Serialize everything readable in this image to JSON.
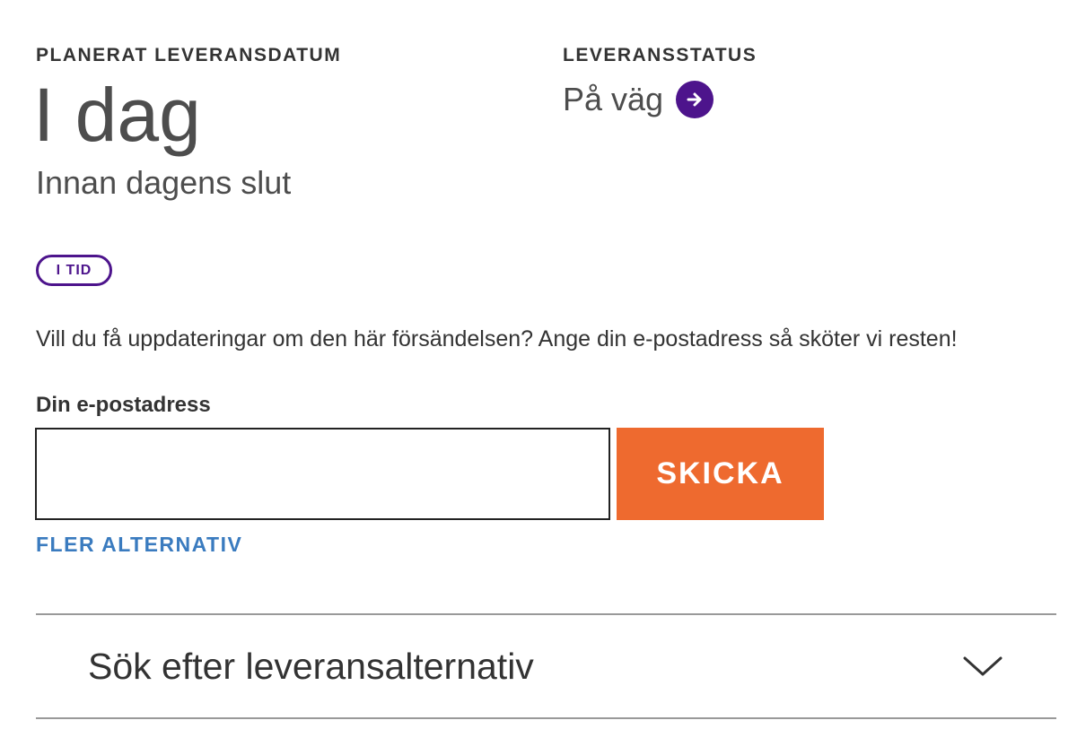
{
  "delivery": {
    "label": "PLANERAT LEVERANSDATUM",
    "day": "I dag",
    "time": "Innan dagens slut",
    "badge": "I TID"
  },
  "status": {
    "label": "LEVERANSSTATUS",
    "text": "På väg",
    "icon": "arrow-right-circle-icon",
    "icon_color": "#4d148c"
  },
  "notify": {
    "prompt": "Vill du få uppdateringar om den här försändelsen? Ange din e-postadress så sköter vi resten!",
    "email_label": "Din e-postadress",
    "email_value": "",
    "submit_label": "SKICKA",
    "submit_color": "#ee6a2f",
    "more_options": "FLER ALTERNATIV"
  },
  "accordion": {
    "title": "Sök efter leveransalternativ",
    "icon": "chevron-down-icon"
  }
}
